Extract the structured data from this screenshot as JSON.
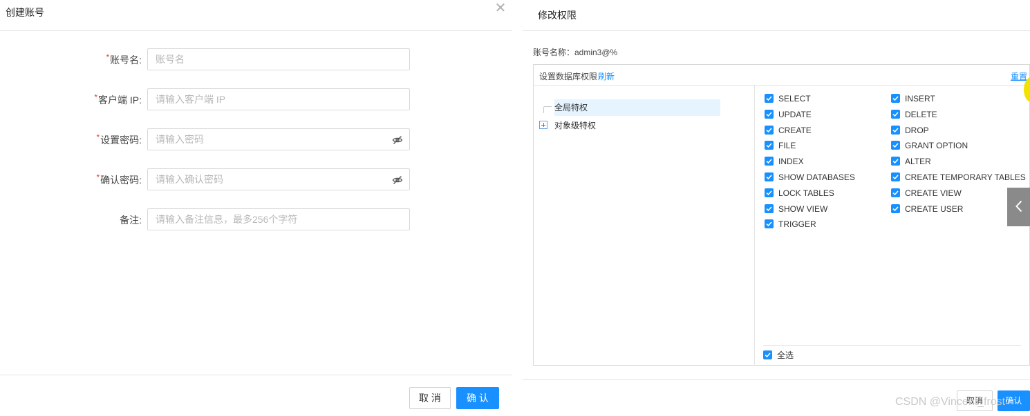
{
  "create_account": {
    "title": "创建账号",
    "fields": [
      {
        "label": "账号名:",
        "required": true,
        "placeholder": "账号名",
        "has_eye": false
      },
      {
        "label": "客户端 IP:",
        "required": true,
        "placeholder": "请输入客户端 IP",
        "has_eye": false
      },
      {
        "label": "设置密码:",
        "required": true,
        "placeholder": "请输入密码",
        "has_eye": true
      },
      {
        "label": "确认密码:",
        "required": true,
        "placeholder": "请输入确认密码",
        "has_eye": true
      },
      {
        "label": "备注:",
        "required": false,
        "placeholder": "请输入备注信息，最多256个字符",
        "has_eye": false
      }
    ],
    "required_mark": "*",
    "cancel_label": "取 消",
    "confirm_label": "确 认"
  },
  "modify_permissions": {
    "title": "修改权限",
    "account_label": "账号名称：admin3@%",
    "box_label": "设置数据库权限",
    "refresh_label": "刷新",
    "reset_label": "重置",
    "tree": {
      "global": "全局特权",
      "object": "对象级特权"
    },
    "privileges_left": [
      {
        "name": "SELECT",
        "checked": true
      },
      {
        "name": "UPDATE",
        "checked": true
      },
      {
        "name": "CREATE",
        "checked": true
      },
      {
        "name": "FILE",
        "checked": true
      },
      {
        "name": "INDEX",
        "checked": true
      },
      {
        "name": "SHOW DATABASES",
        "checked": true
      },
      {
        "name": "LOCK TABLES",
        "checked": true
      },
      {
        "name": "SHOW VIEW",
        "checked": true
      },
      {
        "name": "TRIGGER",
        "checked": true
      }
    ],
    "privileges_right": [
      {
        "name": "INSERT",
        "checked": true
      },
      {
        "name": "DELETE",
        "checked": true
      },
      {
        "name": "DROP",
        "checked": true
      },
      {
        "name": "GRANT OPTION",
        "checked": true
      },
      {
        "name": "ALTER",
        "checked": true
      },
      {
        "name": "CREATE TEMPORARY TABLES",
        "checked": true
      },
      {
        "name": "CREATE VIEW",
        "checked": true
      },
      {
        "name": "CREATE USER",
        "checked": true
      }
    ],
    "select_all_label": "全选",
    "select_all_checked": true,
    "cancel_label": "取消",
    "confirm_label": "确认"
  },
  "watermark": "CSDN @Vincent_frost",
  "colors": {
    "primary": "#1890ff",
    "required": "#e5413b",
    "tree_selected_bg": "#e6f4ff"
  },
  "icons": {
    "close": "close-icon",
    "eye_off": "eye-off-icon",
    "expand": "plus-square-icon",
    "collapse_handle": "chevron-left-icon",
    "checkbox": "checkbox-checked-icon"
  }
}
